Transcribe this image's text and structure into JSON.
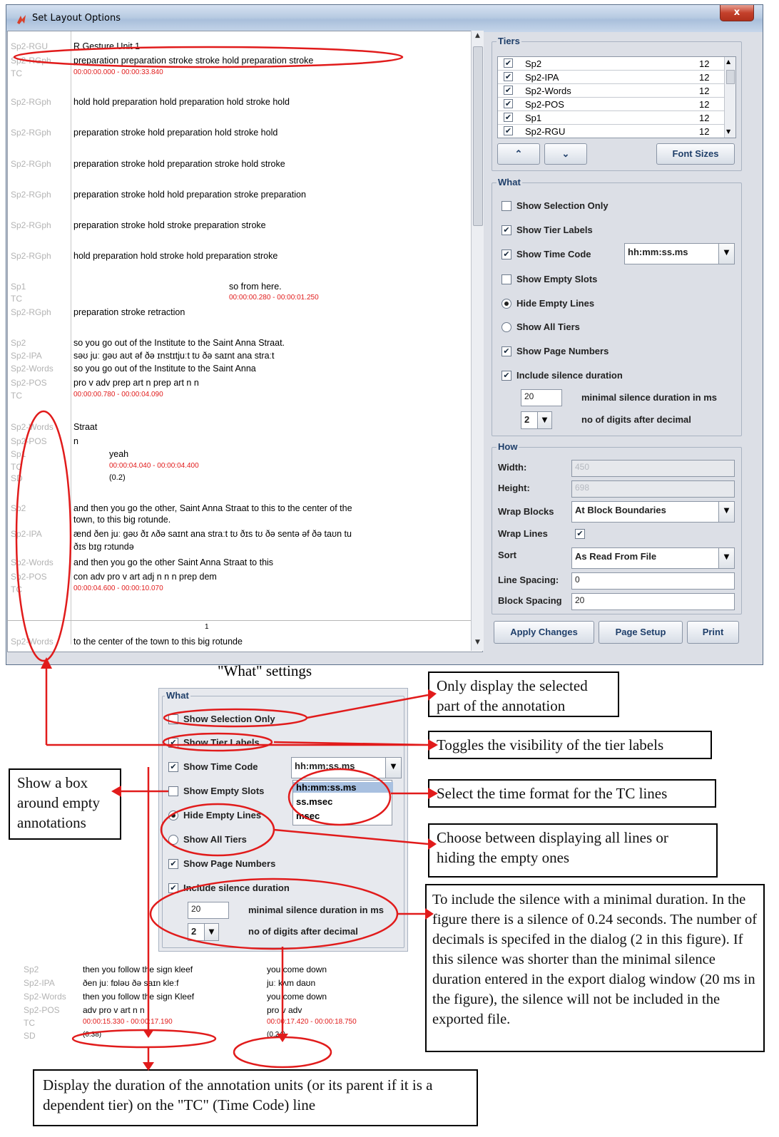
{
  "window": {
    "title": "Set Layout Options",
    "close_glyph": "x"
  },
  "preview": {
    "lines": [
      {
        "label": "Sp2-RGU",
        "text": "R Gesture Unit 1"
      },
      {
        "label": "Sp2-RGph",
        "text": "preparation  preparation  stroke  stroke  hold  preparation  stroke"
      },
      {
        "label": "TC",
        "text": "00:00:00.000 - 00:00:33.840"
      },
      {
        "label": "Sp2-RGph",
        "text": "hold  hold  preparation  hold  preparation  hold  stroke  hold"
      },
      {
        "label": "Sp2-RGph",
        "text": "preparation  stroke  hold  preparation  hold  stroke  hold"
      },
      {
        "label": "Sp2-RGph",
        "text": "preparation  stroke  hold  preparation  stroke  hold  stroke"
      },
      {
        "label": "Sp2-RGph",
        "text": "preparation  stroke  hold  hold  preparation  stroke  preparation"
      },
      {
        "label": "Sp2-RGph",
        "text": "preparation  stroke  hold  stroke  preparation  stroke"
      },
      {
        "label": "Sp2-RGph",
        "text": "hold  preparation  hold  stroke  hold  preparation  stroke"
      },
      {
        "label": "Sp1",
        "text": "so from here."
      },
      {
        "label": "TC",
        "text": "00:00:00.280 - 00:00:01.250"
      },
      {
        "label": "Sp2-RGph",
        "text": "preparation  stroke  retraction"
      },
      {
        "label": "Sp2",
        "text": "so you go out of the Institute to the Saint Anna Straat."
      },
      {
        "label": "Sp2-IPA",
        "text": "səʊ  juː ɡəʊ aʊt əf ðə ɪnstɪtjuːt tʊ ðə saɪnt ana straːt"
      },
      {
        "label": "Sp2-Words",
        "text": "so   you   go   out   of     the  Institute  to      the   Saint   Anna"
      },
      {
        "label": "Sp2-POS",
        "text": "     pro   v     adv  prep  art   n            prep  art   n         n"
      },
      {
        "label": "TC",
        "text": "00:00:00.780 - 00:00:04.090"
      },
      {
        "label": "Sp2-Words",
        "text": "Straat"
      },
      {
        "label": "Sp2-POS",
        "text": "n"
      },
      {
        "label": "Sp1",
        "text": "yeah"
      },
      {
        "label": "TC",
        "text": "00:00:04.040 - 00:00:04.400"
      },
      {
        "label": "SD",
        "text": "(0.2)"
      },
      {
        "label": "Sp2",
        "text": "and then you go the other, Saint Anna Straat to this to the center of the"
      },
      {
        "label": "",
        "text": "town, to this big rotunde."
      },
      {
        "label": "Sp2-IPA",
        "text": "ænd ðen juː ɡəʊ ðɪ ʌðə saɪnt ana straːt tʊ ðɪs tʊ ðə sentə əf ðə taʊn tu"
      },
      {
        "label": "",
        "text": "ðɪs bɪɡ rɔtundə"
      },
      {
        "label": "Sp2-Words",
        "text": "and   then   you   go   the   other   Saint   Anna   Straat   to       this"
      },
      {
        "label": "Sp2-POS",
        "text": "con   adv    pro    v     art    adj      n         n         n           prep   dem"
      },
      {
        "label": "TC",
        "text": "00:00:04.600 - 00:00:10.070"
      },
      {
        "label": "Sp2-Words",
        "text": "to     the   center   of      the   town   to      this    big   rotunde"
      }
    ],
    "page_number": "1"
  },
  "tiers": {
    "title": "Tiers",
    "items": [
      {
        "name": "Sp2",
        "size": "12"
      },
      {
        "name": "Sp2-IPA",
        "size": "12"
      },
      {
        "name": "Sp2-Words",
        "size": "12"
      },
      {
        "name": "Sp2-POS",
        "size": "12"
      },
      {
        "name": "Sp1",
        "size": "12"
      },
      {
        "name": "Sp2-RGU",
        "size": "12"
      }
    ],
    "up_glyph": "⌃",
    "down_glyph": "⌄",
    "font_sizes_label": "Font Sizes"
  },
  "what": {
    "title": "What",
    "show_selection_only": "Show Selection Only",
    "show_tier_labels": "Show Tier Labels",
    "show_time_code": "Show Time Code",
    "time_format": "hh:mm:ss.ms",
    "show_empty_slots": "Show Empty Slots",
    "hide_empty_lines": "Hide Empty Lines",
    "show_all_tiers": "Show All Tiers",
    "show_page_numbers": "Show Page Numbers",
    "include_silence": "Include silence duration",
    "min_silence_value": "20",
    "min_silence_label": "minimal silence duration in ms",
    "digits_value": "2",
    "digits_label": "no of digits after decimal"
  },
  "how": {
    "title": "How",
    "width_label": "Width:",
    "width_value": "450",
    "height_label": "Height:",
    "height_value": "698",
    "wrap_blocks_label": "Wrap Blocks",
    "wrap_blocks_value": "At Block Boundaries",
    "wrap_lines_label": "Wrap Lines",
    "sort_label": "Sort",
    "sort_value": "As Read From File",
    "line_spacing_label": "Line Spacing:",
    "line_spacing_value": "0",
    "block_spacing_label": "Block Spacing",
    "block_spacing_value": "20"
  },
  "buttons": {
    "apply": "Apply Changes",
    "page_setup": "Page Setup",
    "print": "Print"
  },
  "diagram": {
    "caption": "\"What\" settings",
    "time_format_options": [
      "hh:mm:ss.ms",
      "ss.msec",
      "msec"
    ],
    "callouts": {
      "selection": "Only display the selected part of the annotation",
      "tier_labels": "Toggles the visibility of the tier labels",
      "empty_slots": "Show a box around empty annotations",
      "time_format": "Select the time format for the TC lines",
      "lines": "Choose between displaying all lines or hiding the empty ones",
      "silence": "To include the silence with a minimal duration. In the figure there is a silence of 0.24 seconds. The number of decimals is specifed in the dialog (2 in this figure). If this silence was shorter than the minimal silence duration entered in the export dialog window (20 ms in the figure), the silence will not be included in the exported file.",
      "duration": "Display the duration of the annotation units (or its parent if it is a dependent tier) on the \"TC\" (Time Code) line"
    },
    "example": {
      "labels": [
        "Sp2",
        "Sp2-IPA",
        "Sp2-Words",
        "Sp2-POS",
        "TC",
        "SD"
      ],
      "col1": [
        "then you follow the sign kleef",
        "ðen juː fɒləʊ ðə saɪn kleːf",
        "then   you   follow   the   sign   Kleef",
        "adv    pro   v           art   n        n",
        "00:00:15.330 - 00:00:17.190",
        "(0.38)"
      ],
      "col2": [
        "you come down",
        "juː kʌm daʊn",
        "you   come   down",
        "pro   v          adv",
        "00:00:17.420 - 00:00:18.750",
        "(0.24)"
      ]
    }
  },
  "colors": {
    "accent": "#1f3f6a",
    "annotation_red": "#e11b1b",
    "label_gray": "#b3b3b3"
  }
}
